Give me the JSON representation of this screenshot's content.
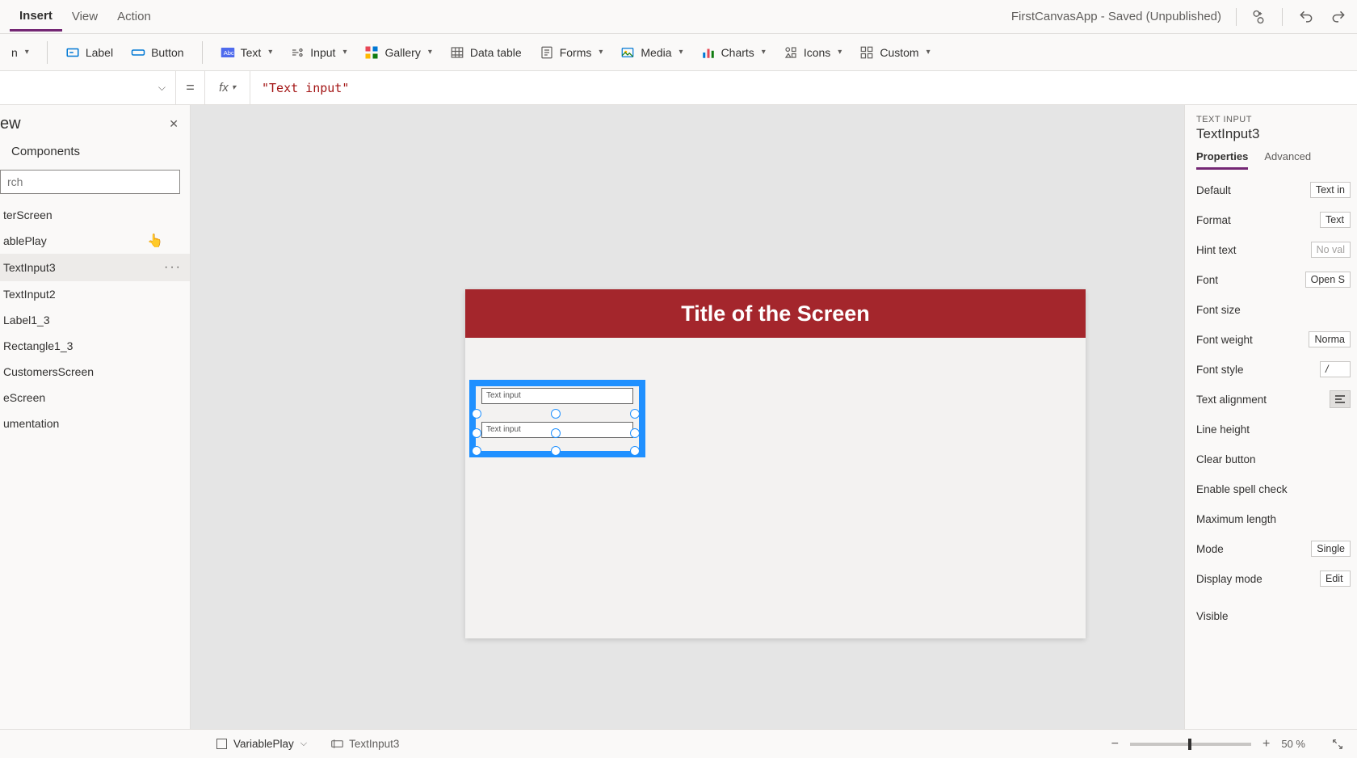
{
  "header": {
    "tabs": [
      "Insert",
      "View",
      "Action"
    ],
    "active_tab": "Insert",
    "app_title": "FirstCanvasApp - Saved (Unpublished)"
  },
  "ribbon": {
    "new_screen": "n",
    "label": "Label",
    "button": "Button",
    "text": "Text",
    "input": "Input",
    "gallery": "Gallery",
    "data_table": "Data table",
    "forms": "Forms",
    "media": "Media",
    "charts": "Charts",
    "icons": "Icons",
    "custom": "Custom"
  },
  "formula": {
    "equals": "=",
    "fx_label": "fx",
    "expression": "\"Text input\""
  },
  "treeview": {
    "title": "ew",
    "tab": "Components",
    "search_placeholder": "rch",
    "items": [
      "terScreen",
      "ablePlay",
      "TextInput3",
      "TextInput2",
      "Label1_3",
      "Rectangle1_3",
      "CustomersScreen",
      "eScreen",
      "umentation"
    ],
    "selected_index": 2
  },
  "canvas": {
    "screen_title": "Title of the Screen",
    "textinput1_value": "Text input",
    "textinput2_value": "Text input"
  },
  "properties": {
    "category": "TEXT INPUT",
    "control_name": "TextInput3",
    "tabs": [
      "Properties",
      "Advanced"
    ],
    "active_tab": "Properties",
    "rows": {
      "default_label": "Default",
      "default_value": "Text in",
      "format_label": "Format",
      "format_value": "Text",
      "hint_label": "Hint text",
      "hint_value": "No val",
      "font_label": "Font",
      "font_value": "Open S",
      "fontsize_label": "Font size",
      "fontweight_label": "Font weight",
      "fontweight_value": "Norma",
      "fontstyle_label": "Font style",
      "fontstyle_value": "/",
      "align_label": "Text alignment",
      "lineheight_label": "Line height",
      "clear_label": "Clear button",
      "spell_label": "Enable spell check",
      "maxlen_label": "Maximum length",
      "mode_label": "Mode",
      "mode_value": "Single",
      "display_label": "Display mode",
      "display_value": "Edit",
      "visible_label": "Visible"
    }
  },
  "status": {
    "screen_name": "VariablePlay",
    "control_name": "TextInput3",
    "zoom_pct": "50  %"
  }
}
